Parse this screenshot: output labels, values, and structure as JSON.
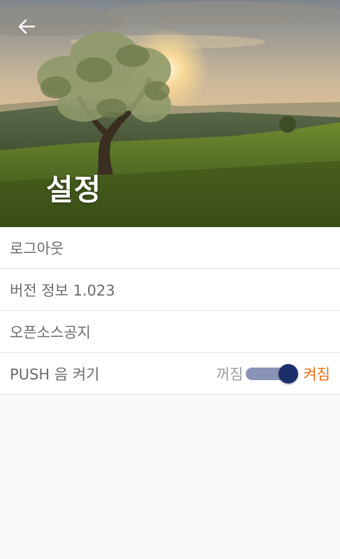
{
  "header": {
    "title": "설정",
    "back_icon": "arrow-left-icon"
  },
  "settings": {
    "items": [
      {
        "label": "로그아웃"
      },
      {
        "label": "버전 정보 1.023"
      },
      {
        "label": "오픈소스공지"
      },
      {
        "label": "PUSH 음 켜기"
      }
    ],
    "push_toggle": {
      "off_label": "꺼짐",
      "on_label": "켜짐",
      "state": "on"
    }
  },
  "colors": {
    "accent_on": "#f26a0a",
    "switch_thumb": "#1b2d6b",
    "switch_track": "#8a93b8"
  }
}
